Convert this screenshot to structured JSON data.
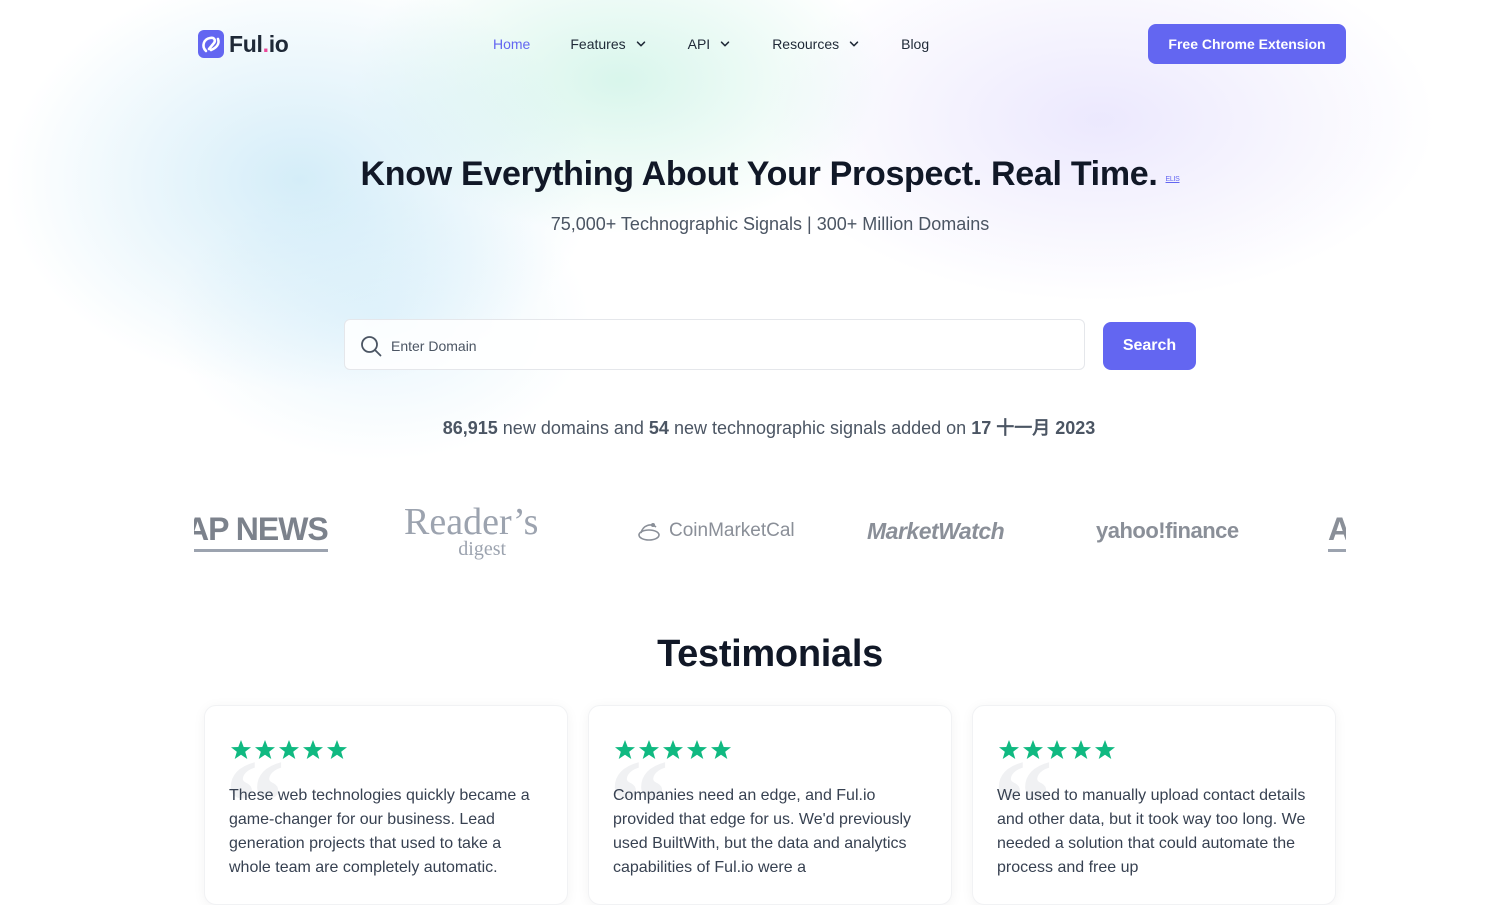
{
  "brand": {
    "name": "Ful",
    "dot_suffix": ".io",
    "accent": "#6366f1",
    "logo_icon": "fulio-logo-icon"
  },
  "nav": {
    "items": [
      {
        "label": "Home",
        "active": true,
        "dropdown": false
      },
      {
        "label": "Features",
        "active": false,
        "dropdown": true
      },
      {
        "label": "API",
        "active": false,
        "dropdown": true
      },
      {
        "label": "Resources",
        "active": false,
        "dropdown": true
      },
      {
        "label": "Blog",
        "active": false,
        "dropdown": false
      }
    ],
    "cta_label": "Free Chrome Extension"
  },
  "hero": {
    "title": "Know Everything About Your Prospect. Real Time.",
    "badge": "ELIS",
    "subtitle": "75,000+ Technographic Signals | 300+ Million Domains"
  },
  "search": {
    "placeholder": "Enter Domain",
    "value": "",
    "button_label": "Search"
  },
  "stats": {
    "domains_count": "86,915",
    "domains_text": "new domains and",
    "signals_count": "54",
    "signals_text": "new technographic signals added on",
    "date": "17 十一月 2023"
  },
  "logos": {
    "apnews": "AP NEWS",
    "readers_line1": "Reader’s",
    "readers_line2": "digest",
    "coinmarketcal": "CoinMarketCal",
    "marketwatch": "MarketWatch",
    "yahoo_finance": "yahoo!finance",
    "partial_next": "A"
  },
  "testimonials": {
    "heading": "Testimonials",
    "rating": 5,
    "star_color": "#10b981",
    "cards": [
      {
        "text": "These web technologies quickly became a game-changer for our business. Lead generation projects that used to take a whole team are completely automatic."
      },
      {
        "text": "Companies need an edge, and Ful.io provided that edge for us. We'd previously used BuiltWith, but the data and analytics capabilities of Ful.io were a"
      },
      {
        "text": "We used to manually upload contact details and other data, but it took way too long. We needed a solution that could automate the process and free up"
      }
    ]
  }
}
